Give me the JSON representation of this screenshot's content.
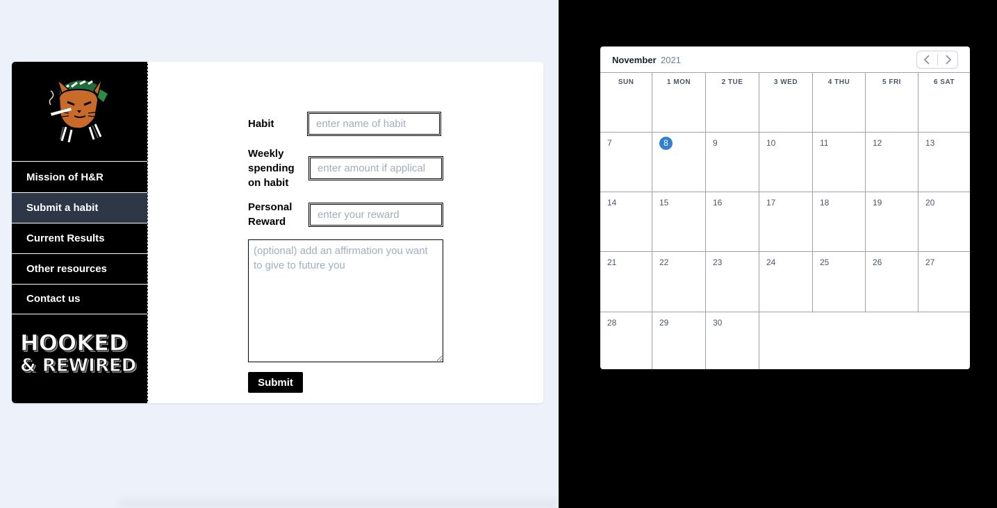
{
  "nav": {
    "items": [
      {
        "label": "Mission of H&R"
      },
      {
        "label": "Submit a habit"
      },
      {
        "label": "Current Results"
      },
      {
        "label": "Other resources"
      },
      {
        "label": "Contact us"
      }
    ],
    "active_index": 1,
    "wordmark_line1": "HOOKED",
    "wordmark_line2": "& REWIRED"
  },
  "form": {
    "habit_label": "Habit",
    "habit_placeholder": "enter name of habit",
    "spending_label_1": "Weekly",
    "spending_label_2": "spending",
    "spending_label_3": "on habit",
    "spending_placeholder": "enter amount if applical",
    "reward_label_1": "Personal",
    "reward_label_2": "Reward",
    "reward_placeholder": "enter your reward",
    "affirmation_placeholder": "(optional) add an affirmation you want to give to future you",
    "submit_label": "Submit"
  },
  "calendar": {
    "month": "November",
    "year": "2021",
    "prev_icon": "chevron-left-icon",
    "next_icon": "chevron-right-icon",
    "day_headers": [
      "SUN",
      "1 MON",
      "2 TUE",
      "3 WED",
      "4 THU",
      "5  FRI",
      "6 SAT"
    ],
    "weeks": [
      [
        "7",
        "8",
        "9",
        "10",
        "11",
        "12",
        "13"
      ],
      [
        "14",
        "15",
        "16",
        "17",
        "18",
        "19",
        "20"
      ],
      [
        "21",
        "22",
        "23",
        "24",
        "25",
        "26",
        "27"
      ],
      [
        "28",
        "29",
        "30"
      ]
    ],
    "today": "8",
    "today_color": "#3182ce"
  },
  "colors": {
    "page_bg": "#edf2fa",
    "sidebar_bg": "#000000",
    "active_nav_bg": "#2d3748",
    "placeholder": "#a0aec0"
  }
}
